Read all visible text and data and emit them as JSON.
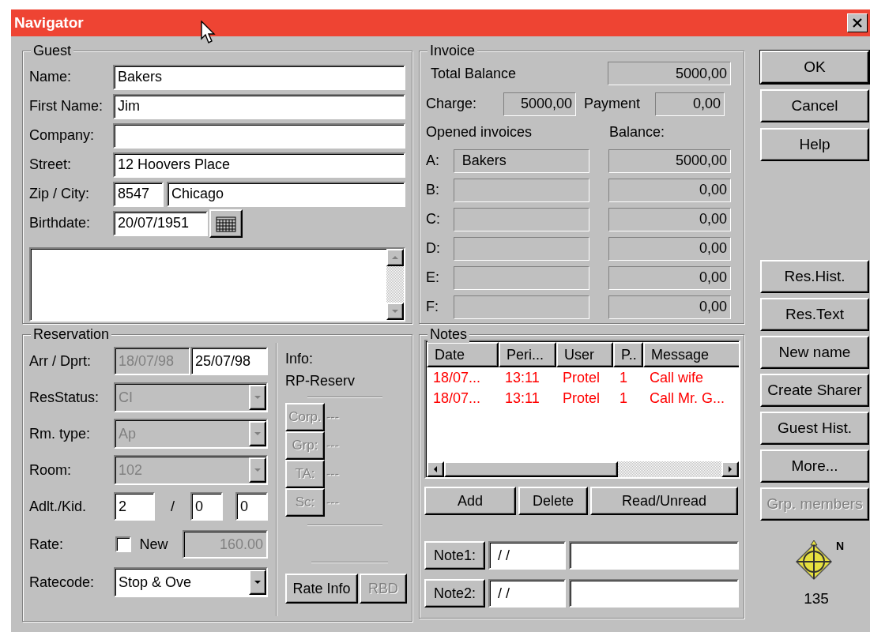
{
  "window": {
    "title": "Navigator"
  },
  "guest": {
    "title": "Guest",
    "fields": [
      {
        "label": "Name:",
        "value": "Bakers"
      },
      {
        "label": "First Name:",
        "value": "Jim"
      },
      {
        "label": "Company:"
      },
      {
        "label": "Street:",
        "value": "12 Hoovers Place"
      }
    ],
    "zip_city": {
      "label": "Zip / City:",
      "zip": "8547",
      "city": "Chicago"
    },
    "birthdate": {
      "label": "Birthdate:",
      "value": "20/07/1951"
    }
  },
  "invoice": {
    "title": "Invoice",
    "total_label": "Total Balance",
    "total": "5000,00",
    "charge_label": "Charge:",
    "charge": "5000,00",
    "payment_label": "Payment",
    "payment": "0,00",
    "opened_label": "Opened invoices",
    "balance_label": "Balance:",
    "rows": [
      {
        "letter": "A:",
        "name": "Bakers",
        "balance": "5000,00"
      },
      {
        "letter": "B:",
        "balance": "0,00"
      },
      {
        "letter": "C:",
        "balance": "0,00"
      },
      {
        "letter": "D:",
        "balance": "0,00"
      },
      {
        "letter": "E:",
        "balance": "0,00"
      },
      {
        "letter": "F:",
        "balance": "0,00"
      }
    ]
  },
  "buttons": [
    {
      "label": "OK",
      "default": true
    },
    {
      "label": "Cancel",
      "default": false
    },
    {
      "label": "Help",
      "default": false
    }
  ],
  "side_buttons": [
    {
      "label": "Res.Hist.",
      "disabled": false
    },
    {
      "label": "Res.Text",
      "disabled": false
    },
    {
      "label": "New name",
      "disabled": false
    },
    {
      "label": "Create Sharer",
      "disabled": false
    },
    {
      "label": "Guest Hist.",
      "disabled": false
    },
    {
      "label": "More...",
      "disabled": false
    },
    {
      "label": "Grp. members",
      "disabled": true
    }
  ],
  "reservation": {
    "title": "Reservation",
    "arr_dprt": {
      "label": "Arr / Dprt:",
      "arrival": "18/07/98",
      "arrival_disabled": true,
      "departure": "25/07/98"
    },
    "combos": [
      {
        "label": "ResStatus:",
        "value": "CI",
        "disabled": true
      },
      {
        "label": "Rm. type:",
        "value": "Ap",
        "disabled": true
      },
      {
        "label": "Room:",
        "value": "102",
        "disabled": true
      }
    ],
    "adults_kids": {
      "label": "Adlt./Kid.",
      "adults": "2",
      "separator": "/",
      "kids": [
        "0",
        "0"
      ]
    },
    "rate": {
      "label": "Rate:",
      "checked": false,
      "new_label": "New",
      "value": "160.00",
      "disabled": true
    },
    "ratecode": {
      "label": "Ratecode:",
      "value": "Stop & Ove",
      "disabled": false
    },
    "info": {
      "label": "Info:",
      "value": "RP-Reserv",
      "links": [
        {
          "label": "Corp.",
          "disabled": true
        },
        {
          "label": "Grp:",
          "disabled": true
        },
        {
          "label": "TA:",
          "disabled": true
        },
        {
          "label": "Sc:",
          "disabled": true
        }
      ],
      "link_values": [
        "---",
        "---",
        "---",
        "---"
      ],
      "buttons": [
        {
          "label": "Rate Info",
          "disabled": false
        },
        {
          "label": "RBD",
          "disabled": true
        }
      ]
    }
  },
  "notes": {
    "title": "Notes",
    "columns": [
      "Date",
      "Peri...",
      "User",
      "P..",
      "Message"
    ],
    "rows": [
      {
        "cells": [
          "18/07...",
          "13:11",
          "Protel",
          "1",
          "Call wife"
        ],
        "color": "#ff0000"
      },
      {
        "cells": [
          "18/07...",
          "13:11",
          "Protel",
          "1",
          "Call Mr. G..."
        ],
        "color": "#ff0000"
      }
    ],
    "buttons": [
      "Add",
      "Delete",
      "Read/Unread"
    ],
    "note_lines": [
      {
        "label": "Note1:",
        "date": "/ /"
      },
      {
        "label": "Note2:",
        "date": "/ /"
      }
    ]
  },
  "compass": {
    "north": "N",
    "heading": "135"
  }
}
